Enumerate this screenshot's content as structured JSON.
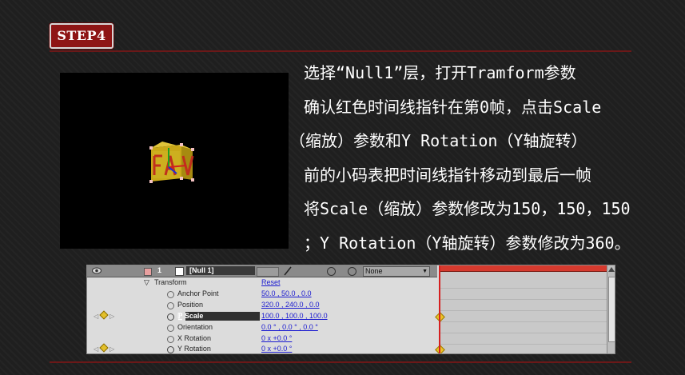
{
  "step_label": "STEP4",
  "instructions": [
    "选择“Null1”层，打开Tramform参数",
    "确认红色时间线指针在第0帧，点击Scale",
    "（缩放）参数和Y Rotation（Y轴旋转）",
    "前的小码表把时间线指针移动到最后一帧",
    "将Scale（缩放）参数修改为150，150，150",
    "；Y Rotation（Y轴旋转）参数修改为360。"
  ],
  "timeline": {
    "layer_number": "1",
    "layer_name": "[Null 1]",
    "parent_value": "None",
    "transform_label": "Transform",
    "reset_label": "Reset",
    "properties": [
      {
        "name": "Anchor Point",
        "value": "50.0 , 50.0 , 0.0"
      },
      {
        "name": "Position",
        "value": "320.0 , 240.0 , 0.0"
      },
      {
        "name": "Scale",
        "value": "100.0 , 100.0 , 100.0"
      },
      {
        "name": "Orientation",
        "value": "0.0 ° , 0.0 ° , 0.0 °"
      },
      {
        "name": "X Rotation",
        "value": "0 x +0.0 °"
      },
      {
        "name": "Y Rotation",
        "value": "0 x +0.0 °"
      }
    ],
    "keyframed_properties": [
      "Scale",
      "Y Rotation"
    ],
    "colors": {
      "accent_red": "#d62020",
      "badge_red": "#8e1515",
      "value_blue": "#1a1ad0",
      "keyframe_yellow": "#e9c229"
    }
  },
  "icons": [
    "eye-icon",
    "stopwatch-icon",
    "keyframe-icon",
    "scroll-up-icon",
    "dropdown-arrow-icon"
  ]
}
